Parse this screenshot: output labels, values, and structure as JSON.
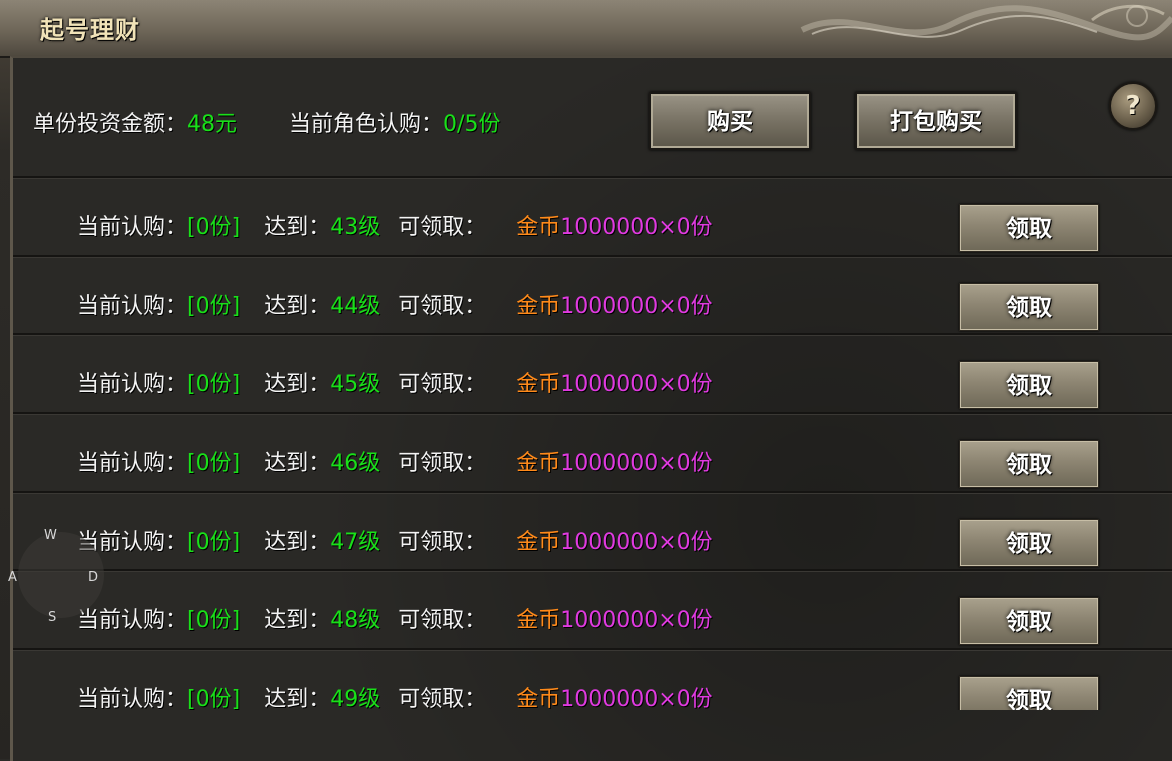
{
  "window": {
    "title": "起号理财"
  },
  "summary": {
    "unit_amount_label": "单份投资金额：",
    "unit_amount_value": "48元",
    "subscribed_label": "当前角色认购：",
    "subscribed_value": "0/5份"
  },
  "buttons": {
    "buy": "购买",
    "bundle_buy": "打包购买",
    "help": "?"
  },
  "row_labels": {
    "current": "当前认购：",
    "reach": "达到：",
    "claimable": "可领取：",
    "reward_name": "金币",
    "claim": "领取"
  },
  "rows": [
    {
      "current": "[0份]",
      "level": "43级",
      "reward_amount": "1000000×0份"
    },
    {
      "current": "[0份]",
      "level": "44级",
      "reward_amount": "1000000×0份"
    },
    {
      "current": "[0份]",
      "level": "45级",
      "reward_amount": "1000000×0份"
    },
    {
      "current": "[0份]",
      "level": "46级",
      "reward_amount": "1000000×0份"
    },
    {
      "current": "[0份]",
      "level": "47级",
      "reward_amount": "1000000×0份"
    },
    {
      "current": "[0份]",
      "level": "48级",
      "reward_amount": "1000000×0份"
    },
    {
      "current": "[0份]",
      "level": "49级",
      "reward_amount": "1000000×0份"
    }
  ],
  "joystick": {
    "up": "W",
    "left": "A",
    "right": "D",
    "down": "S"
  },
  "colors": {
    "value_green": "#19e019",
    "reward_orange": "#ff8a1a",
    "reward_magenta": "#e03ae0",
    "title_gold": "#f1e3b8"
  }
}
